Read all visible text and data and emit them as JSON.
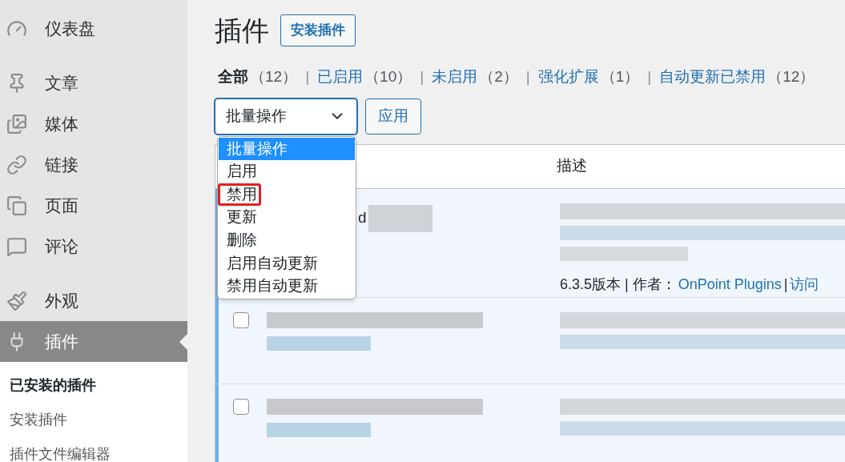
{
  "sidebar": {
    "groups": [
      {
        "items": [
          {
            "label": "仪表盘",
            "selected": false
          }
        ]
      },
      {
        "items": [
          {
            "label": "文章",
            "selected": false
          },
          {
            "label": "媒体",
            "selected": false
          },
          {
            "label": "链接",
            "selected": false
          },
          {
            "label": "页面",
            "selected": false
          },
          {
            "label": "评论",
            "selected": false
          }
        ]
      },
      {
        "items": [
          {
            "label": "外观",
            "selected": false
          },
          {
            "label": "插件",
            "selected": true
          }
        ]
      }
    ],
    "submenu": [
      {
        "label": "已安装的插件",
        "selected": true
      },
      {
        "label": "安装插件",
        "selected": false
      },
      {
        "label": "插件文件编辑器",
        "selected": false
      }
    ]
  },
  "page": {
    "title": "插件",
    "add_button": "安装插件"
  },
  "filters": [
    {
      "label": "全部",
      "count": "（12）",
      "selected": true
    },
    {
      "separator": "|",
      "label": "已启用",
      "count": "（10）",
      "selected": false
    },
    {
      "separator": "|",
      "label": "未启用",
      "count": "（2）",
      "selected": false
    },
    {
      "separator": "|",
      "label": "强化扩展",
      "count": "（1）",
      "selected": false
    },
    {
      "separator": "|",
      "label": "自动更新已禁用",
      "count": "（12）",
      "selected": false
    }
  ],
  "bulk": {
    "value": "批量操作",
    "apply": "应用",
    "options": [
      {
        "label": "批量操作",
        "highlighted": true,
        "marked": false
      },
      {
        "label": "启用",
        "highlighted": false,
        "marked": false
      },
      {
        "label": "禁用",
        "highlighted": false,
        "marked": true
      },
      {
        "label": "更新",
        "highlighted": false,
        "marked": false
      },
      {
        "label": "删除",
        "highlighted": false,
        "marked": false
      },
      {
        "label": "启用自动更新",
        "highlighted": false,
        "marked": false
      },
      {
        "label": "禁用自动更新",
        "highlighted": false,
        "marked": false
      }
    ]
  },
  "table": {
    "columns": [
      "描述"
    ],
    "rows": [
      {
        "active": true,
        "name_fragment": "d",
        "version": "6.3.5版本 | 作者：",
        "author": "OnPoint Plugins",
        "separator": "|",
        "link": "访问"
      },
      {
        "active": true,
        "checked": false
      },
      {
        "active": true,
        "checked": false
      }
    ]
  }
}
